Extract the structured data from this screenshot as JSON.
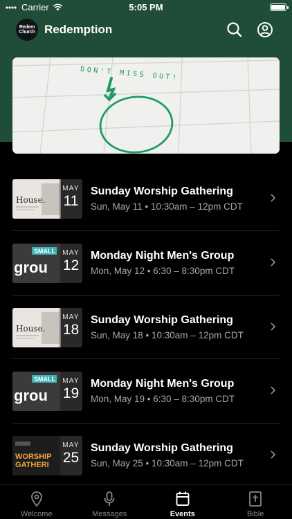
{
  "status_bar": {
    "carrier": "Carrier",
    "time": "5:05 PM"
  },
  "header": {
    "logo_text_1": "Redem",
    "logo_text_2": "Church",
    "title": "Redemption"
  },
  "hero": {
    "handwriting": "DON'T MISS OUT!"
  },
  "events": [
    {
      "month": "MAY",
      "day": "11",
      "title": "Sunday Worship Gathering",
      "subtitle": "Sun, May 11 • 10:30am – 12pm CDT",
      "art_line1": "House.",
      "art_line2": ""
    },
    {
      "month": "MAY",
      "day": "12",
      "title": "Monday Night Men's Group",
      "subtitle": "Mon, May 12 • 6:30 – 8:30pm CDT",
      "art_line1": "SMALL",
      "art_line2": "grou"
    },
    {
      "month": "MAY",
      "day": "18",
      "title": "Sunday Worship Gathering",
      "subtitle": "Sun, May 18 • 10:30am – 12pm CDT",
      "art_line1": "House.",
      "art_line2": ""
    },
    {
      "month": "MAY",
      "day": "19",
      "title": "Monday Night Men's Group",
      "subtitle": "Mon, May 19 • 6:30 – 8:30pm CDT",
      "art_line1": "SMALL",
      "art_line2": "grou"
    },
    {
      "month": "MAY",
      "day": "25",
      "title": "Sunday Worship Gathering",
      "subtitle": "Sun, May 25 • 10:30am – 12pm CDT",
      "art_line1": "WORSHIP",
      "art_line2": "GATHERI"
    }
  ],
  "tabs": [
    {
      "label": "Welcome",
      "icon": "location-pin-icon"
    },
    {
      "label": "Messages",
      "icon": "microphone-icon"
    },
    {
      "label": "Events",
      "icon": "calendar-icon",
      "active": true
    },
    {
      "label": "Bible",
      "icon": "bible-icon"
    }
  ],
  "colors": {
    "header": "#1f4d37",
    "background": "#000000",
    "hero_ink_green": "#1e9b63"
  }
}
